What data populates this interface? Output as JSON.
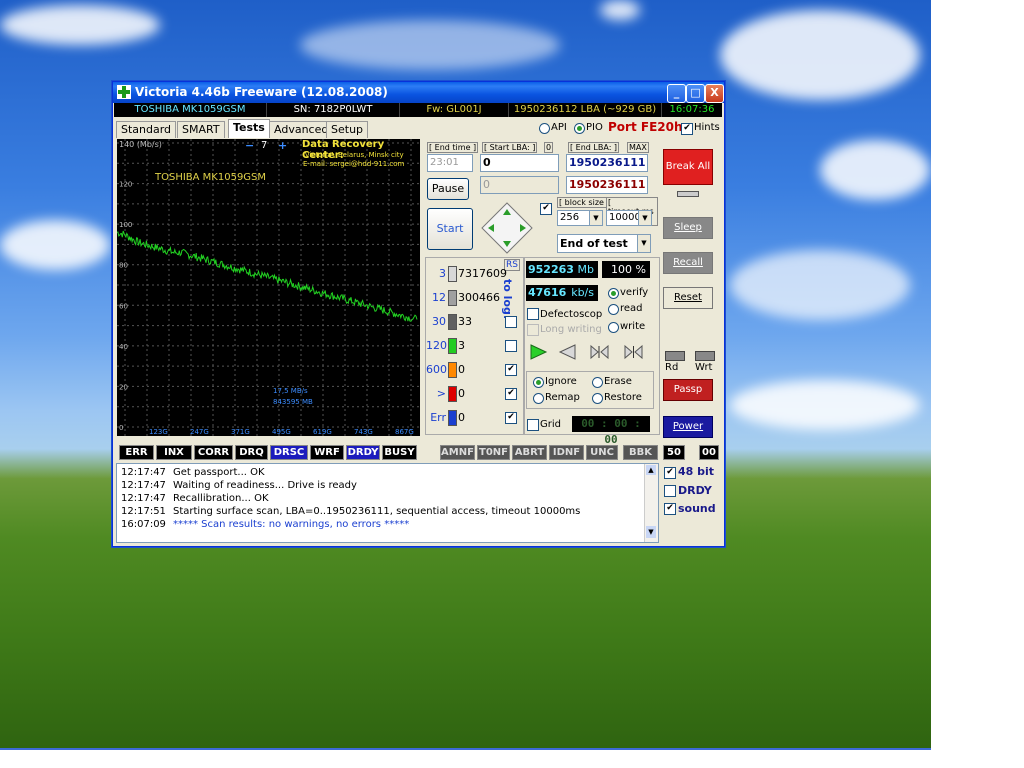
{
  "window": {
    "title": "Victoria 4.46b Freeware (12.08.2008)",
    "minimize": "_",
    "maximize": "□",
    "close": "X"
  },
  "infobar": {
    "model": "TOSHIBA MK1059GSM",
    "serial": "SN: 7182P0LWT",
    "firmware": "Fw: GL001J",
    "capacity": "1950236112 LBA (~929 GB)",
    "clock": "16:07:36"
  },
  "tabs": [
    "Standard",
    "SMART",
    "Tests",
    "Advanced",
    "Setup"
  ],
  "active_tab": "Tests",
  "mode": {
    "api": "API",
    "pio": "PIO",
    "port": "Port FE20h",
    "hints": "Hints"
  },
  "graph": {
    "scale_top": "140 (Mb/s)",
    "y_labels": [
      "120",
      "100",
      "80",
      "60",
      "40",
      "20",
      "0"
    ],
    "x_labels": [
      "123G",
      "247G",
      "371G",
      "495G",
      "619G",
      "743G",
      "867G"
    ],
    "minus": "−",
    "zoom": "7",
    "plus": "+",
    "drc_title": "Data Recovery Center:",
    "drc_line1": "'Victoria', Belarus, Minsk city",
    "drc_line2": "E-mail: sergei@hdd-911.com",
    "drive_label": "TOSHIBA MK1059GSM",
    "speed": "17,5 MB/s",
    "total": "843595 MB"
  },
  "chart_data": {
    "type": "line",
    "title": "",
    "xlabel": "",
    "ylabel": "140 (Mb/s)",
    "ylim": [
      0,
      140
    ],
    "x_ticks": [
      "123G",
      "247G",
      "371G",
      "495G",
      "619G",
      "743G",
      "867G"
    ],
    "series": [
      {
        "x": [
          0,
          20,
          40,
          60,
          80,
          100,
          120,
          140,
          160,
          180,
          200,
          220,
          240,
          260,
          280,
          300,
          320,
          340,
          360,
          380,
          400,
          420,
          440,
          460,
          480,
          500,
          520,
          540,
          560,
          580,
          600,
          620,
          640,
          660,
          680,
          700,
          720,
          740,
          760,
          780,
          800,
          820,
          843
        ],
        "y": [
          96,
          95,
          93,
          91,
          90,
          89,
          88,
          87,
          86,
          86,
          85,
          84,
          83,
          82,
          81,
          80,
          79,
          78,
          77,
          76,
          75,
          74,
          73,
          72,
          71,
          70,
          69,
          68,
          67,
          66,
          65,
          64,
          63,
          62,
          61,
          60,
          59,
          58,
          57,
          56,
          55,
          54,
          53
        ]
      }
    ]
  },
  "controls": {
    "end_time_label": "[ End time ]",
    "start_lba_label": "[ Start LBA: ]",
    "start_reset": "0",
    "end_lba_label": "[ End LBA: ]",
    "max_label": "MAX",
    "end_time_value": "23:01",
    "start_lba_value": "0",
    "end_lba_value": "1950236111",
    "pause": "Pause",
    "lba2_value": "0",
    "lba2_end": "1950236111",
    "start": "Start",
    "block_size_label": "[ block size ]",
    "timeout_label": "[ timeout,ms ]",
    "block_size": "256",
    "timeout": "10000",
    "end_action": "End of test",
    "rs": "RS",
    "to_log": "to log:",
    "counters": [
      {
        "label": "3",
        "value": "7317609",
        "color": "#d8d8d8"
      },
      {
        "label": "12",
        "value": "300466",
        "color": "#a0a0a0"
      },
      {
        "label": "30",
        "value": "33",
        "color": "#606060"
      },
      {
        "label": "120",
        "value": "3",
        "color": "#22cc22"
      },
      {
        "label": "600",
        "value": "0",
        "color": "#ff8800"
      },
      {
        "label": ">",
        "value": "0",
        "color": "#dd0000"
      },
      {
        "label": "Err",
        "value": "0",
        "color": "#1a3fd0"
      }
    ],
    "mb_value": "952263",
    "mb_unit": "Mb",
    "percent_value": "100",
    "percent_unit": "%",
    "speed_value": "47616",
    "speed_unit": "kb/s",
    "verify": "verify",
    "read": "read",
    "write": "write",
    "defectoscop": "Defectoscop",
    "long_writing": "Long writing",
    "ignore": "Ignore",
    "erase": "Erase",
    "remap": "Remap",
    "restore": "Restore",
    "grid": "Grid",
    "grid_time": "00 : 00 : 00"
  },
  "right": {
    "break_all": "Break All",
    "sleep": "Sleep",
    "recall": "Recall",
    "reset": "Reset",
    "rd": "Rd",
    "wrt": "Wrt",
    "passp": "Passp",
    "power": "Power"
  },
  "status_flags": [
    "ERR",
    "INX",
    "CORR",
    "DRQ",
    "DRSC",
    "WRF",
    "DRDY",
    "BUSY"
  ],
  "error_flags": [
    "AMNF",
    "T0NF",
    "ABRT",
    "IDNF",
    "UNC",
    "BBK"
  ],
  "status_values": {
    "v1": "50",
    "v2": "00"
  },
  "log": [
    {
      "time": "12:17:47",
      "text": "Get passport... OK",
      "color": "#000"
    },
    {
      "time": "12:17:47",
      "text": "Waiting of readiness... Drive is ready",
      "color": "#000"
    },
    {
      "time": "12:17:47",
      "text": "Recallibration... OK",
      "color": "#000"
    },
    {
      "time": "12:17:51",
      "text": "Starting surface scan, LBA=0..1950236111, sequential access, timeout 10000ms",
      "color": "#000"
    },
    {
      "time": "16:07:09",
      "text": "***** Scan results: no warnings, no errors *****",
      "color": "#1a3fd0"
    }
  ],
  "side_checks": {
    "bit48": "48 bit",
    "drdy": "DRDY",
    "sound": "sound"
  }
}
